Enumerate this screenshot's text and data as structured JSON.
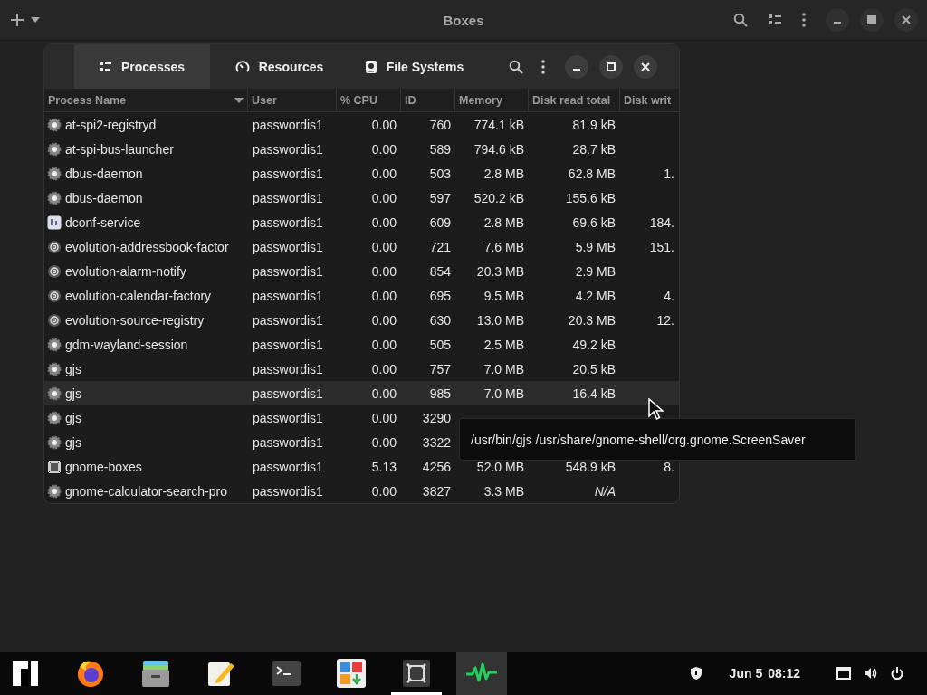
{
  "header": {
    "title": "Boxes"
  },
  "monitor": {
    "tabs": [
      {
        "label": "Processes",
        "kind": "list",
        "selected": true
      },
      {
        "label": "Resources",
        "kind": "gauge",
        "selected": false
      },
      {
        "label": "File Systems",
        "kind": "disk",
        "selected": false
      }
    ],
    "columns": [
      {
        "label": "Process Name",
        "sorted": true
      },
      {
        "label": "User",
        "sorted": false
      },
      {
        "label": "% CPU",
        "sorted": false
      },
      {
        "label": "ID",
        "sorted": false
      },
      {
        "label": "Memory",
        "sorted": false
      },
      {
        "label": "Disk read total",
        "sorted": false
      },
      {
        "label": "Disk writ",
        "sorted": false
      }
    ],
    "rows": [
      {
        "kind": "gear",
        "name": "at-spi2-registryd",
        "user": "passwordis1",
        "cpu": "0.00",
        "id": "760",
        "memory": "774.1 kB",
        "disk_read": "81.9 kB",
        "highlighted": false
      },
      {
        "kind": "gear",
        "name": "at-spi-bus-launcher",
        "user": "passwordis1",
        "cpu": "0.00",
        "id": "589",
        "memory": "794.6 kB",
        "disk_read": "28.7 kB",
        "highlighted": false
      },
      {
        "kind": "gear",
        "name": "dbus-daemon",
        "user": "passwordis1",
        "cpu": "0.00",
        "id": "503",
        "memory": "2.8 MB",
        "disk_read": "62.8 MB",
        "disk_write": "1.",
        "highlighted": false
      },
      {
        "kind": "gear",
        "name": "dbus-daemon",
        "user": "passwordis1",
        "cpu": "0.00",
        "id": "597",
        "memory": "520.2 kB",
        "disk_read": "155.6 kB",
        "highlighted": false
      },
      {
        "kind": "dconf",
        "name": "dconf-service",
        "user": "passwordis1",
        "cpu": "0.00",
        "id": "609",
        "memory": "2.8 MB",
        "disk_read": "69.6 kB",
        "disk_write": "184.",
        "highlighted": false
      },
      {
        "kind": "at",
        "name": "evolution-addressbook-factor",
        "user": "passwordis1",
        "cpu": "0.00",
        "id": "721",
        "memory": "7.6 MB",
        "disk_read": "5.9 MB",
        "disk_write": "151.",
        "highlighted": false
      },
      {
        "kind": "at",
        "name": "evolution-alarm-notify",
        "user": "passwordis1",
        "cpu": "0.00",
        "id": "854",
        "memory": "20.3 MB",
        "disk_read": "2.9 MB",
        "highlighted": false
      },
      {
        "kind": "at",
        "name": "evolution-calendar-factory",
        "user": "passwordis1",
        "cpu": "0.00",
        "id": "695",
        "memory": "9.5 MB",
        "disk_read": "4.2 MB",
        "disk_write": "4.",
        "highlighted": false
      },
      {
        "kind": "at",
        "name": "evolution-source-registry",
        "user": "passwordis1",
        "cpu": "0.00",
        "id": "630",
        "memory": "13.0 MB",
        "disk_read": "20.3 MB",
        "disk_write": "12.",
        "highlighted": false
      },
      {
        "kind": "gear",
        "name": "gdm-wayland-session",
        "user": "passwordis1",
        "cpu": "0.00",
        "id": "505",
        "memory": "2.5 MB",
        "disk_read": "49.2 kB",
        "highlighted": false
      },
      {
        "kind": "gear",
        "name": "gjs",
        "user": "passwordis1",
        "cpu": "0.00",
        "id": "757",
        "memory": "7.0 MB",
        "disk_read": "20.5 kB",
        "highlighted": false
      },
      {
        "kind": "gear",
        "name": "gjs",
        "user": "passwordis1",
        "cpu": "0.00",
        "id": "985",
        "memory": "7.0 MB",
        "disk_read": "16.4 kB",
        "highlighted": true
      },
      {
        "kind": "gear",
        "name": "gjs",
        "user": "passwordis1",
        "cpu": "0.00",
        "id": "3290",
        "highlighted": false
      },
      {
        "kind": "gear",
        "name": "gjs",
        "user": "passwordis1",
        "cpu": "0.00",
        "id": "3322",
        "highlighted": false
      },
      {
        "kind": "boxes",
        "name": "gnome-boxes",
        "user": "passwordis1",
        "cpu": "5.13",
        "id": "4256",
        "memory": "52.0 MB",
        "disk_read": "548.9 kB",
        "disk_write": "8.",
        "highlighted": false
      },
      {
        "kind": "gear",
        "name": "gnome-calculator-search-pro",
        "user": "passwordis1",
        "cpu": "0.00",
        "id": "3827",
        "memory": "3.3 MB",
        "disk_read": "N/A",
        "highlighted": false
      }
    ],
    "tooltip": {
      "text": "/usr/bin/gjs /usr/share/gnome-shell/org.gnome.ScreenSaver"
    }
  },
  "taskbar": {
    "apps": [
      {
        "kind": "logo",
        "running": false,
        "focused": false
      },
      {
        "kind": "browser",
        "running": false,
        "focused": false
      },
      {
        "kind": "files",
        "running": false,
        "focused": false
      },
      {
        "kind": "editor",
        "running": false,
        "focused": false
      },
      {
        "kind": "terminal",
        "running": false,
        "focused": false
      },
      {
        "kind": "software",
        "running": false,
        "focused": false
      },
      {
        "kind": "boxes",
        "running": true,
        "focused": false
      },
      {
        "kind": "monitor",
        "running": false,
        "focused": true
      }
    ],
    "date": "Jun 5",
    "time": "08:12"
  }
}
